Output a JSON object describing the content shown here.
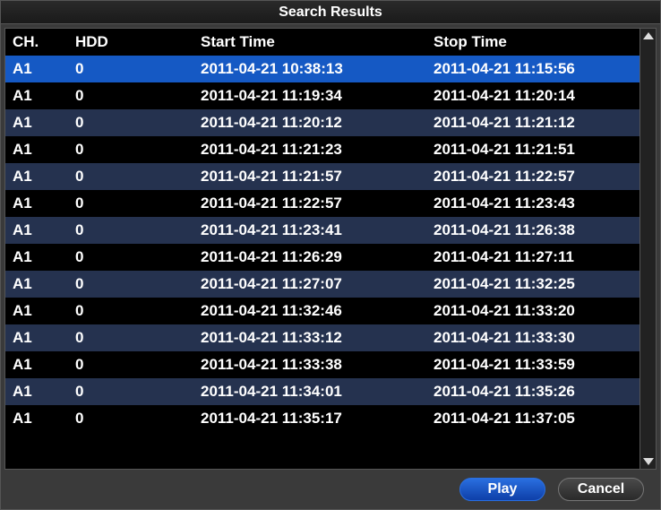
{
  "window": {
    "title": "Search Results"
  },
  "columns": {
    "ch": "CH.",
    "hdd": "HDD",
    "start": "Start Time",
    "stop": "Stop Time"
  },
  "rows": [
    {
      "ch": "A1",
      "hdd": "0",
      "start": "2011-04-21 10:38:13",
      "stop": "2011-04-21 11:15:56",
      "selected": true
    },
    {
      "ch": "A1",
      "hdd": "0",
      "start": "2011-04-21 11:19:34",
      "stop": "2011-04-21 11:20:14"
    },
    {
      "ch": "A1",
      "hdd": "0",
      "start": "2011-04-21 11:20:12",
      "stop": "2011-04-21 11:21:12"
    },
    {
      "ch": "A1",
      "hdd": "0",
      "start": "2011-04-21 11:21:23",
      "stop": "2011-04-21 11:21:51"
    },
    {
      "ch": "A1",
      "hdd": "0",
      "start": "2011-04-21 11:21:57",
      "stop": "2011-04-21 11:22:57"
    },
    {
      "ch": "A1",
      "hdd": "0",
      "start": "2011-04-21 11:22:57",
      "stop": "2011-04-21 11:23:43"
    },
    {
      "ch": "A1",
      "hdd": "0",
      "start": "2011-04-21 11:23:41",
      "stop": "2011-04-21 11:26:38"
    },
    {
      "ch": "A1",
      "hdd": "0",
      "start": "2011-04-21 11:26:29",
      "stop": "2011-04-21 11:27:11"
    },
    {
      "ch": "A1",
      "hdd": "0",
      "start": "2011-04-21 11:27:07",
      "stop": "2011-04-21 11:32:25"
    },
    {
      "ch": "A1",
      "hdd": "0",
      "start": "2011-04-21 11:32:46",
      "stop": "2011-04-21 11:33:20"
    },
    {
      "ch": "A1",
      "hdd": "0",
      "start": "2011-04-21 11:33:12",
      "stop": "2011-04-21 11:33:30"
    },
    {
      "ch": "A1",
      "hdd": "0",
      "start": "2011-04-21 11:33:38",
      "stop": "2011-04-21 11:33:59"
    },
    {
      "ch": "A1",
      "hdd": "0",
      "start": "2011-04-21 11:34:01",
      "stop": "2011-04-21 11:35:26"
    },
    {
      "ch": "A1",
      "hdd": "0",
      "start": "2011-04-21 11:35:17",
      "stop": "2011-04-21 11:37:05"
    }
  ],
  "buttons": {
    "play": "Play",
    "cancel": "Cancel"
  }
}
